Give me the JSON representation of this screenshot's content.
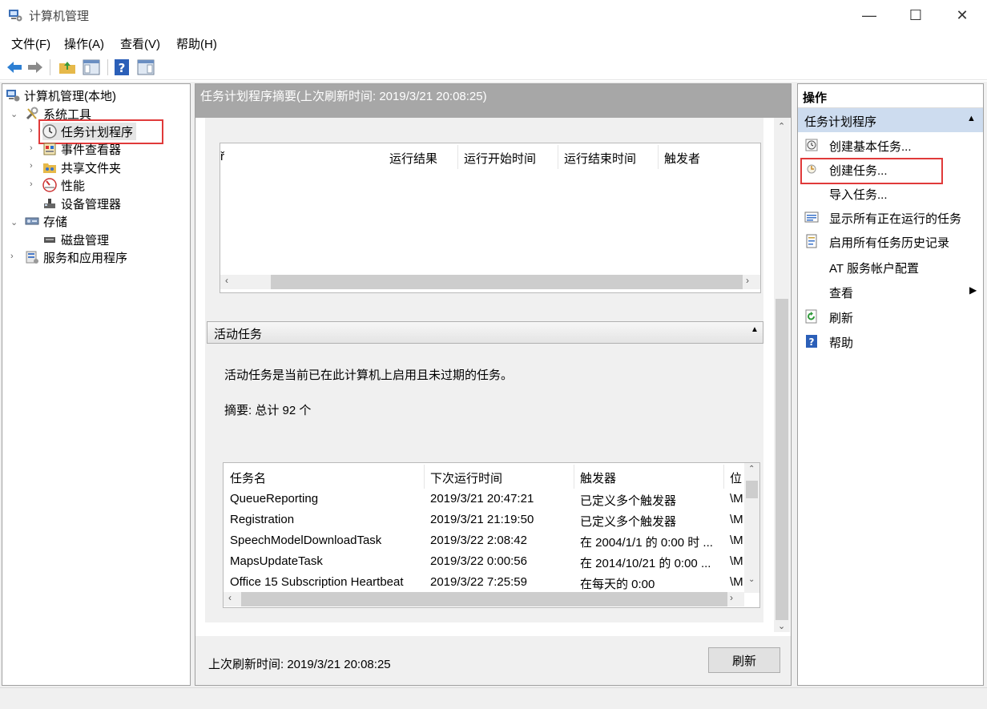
{
  "window": {
    "title": "计算机管理",
    "minimize": "—",
    "maximize": "☐",
    "close": "✕"
  },
  "menu": [
    "文件(F)",
    "操作(A)",
    "查看(V)",
    "帮助(H)"
  ],
  "tree": {
    "root": "计算机管理(本地)",
    "system_tools": "系统工具",
    "task_scheduler": "任务计划程序",
    "event_viewer": "事件查看器",
    "shared_folders": "共享文件夹",
    "performance": "性能",
    "device_manager": "设备管理器",
    "storage": "存储",
    "disk_management": "磁盘管理",
    "services_apps": "服务和应用程序"
  },
  "center": {
    "header": "任务计划程序摘要(上次刷新时间: 2019/3/21 20:08:25)",
    "top_table_cols": [
      "ř",
      "运行结果",
      "运行开始时间",
      "运行结束时间",
      "触发者"
    ],
    "active_section_title": "活动任务",
    "active_desc": "活动任务是当前已在此计算机上启用且未过期的任务。",
    "summary": "摘要: 总计 92 个",
    "task_cols": [
      "任务名",
      "下次运行时间",
      "触发器",
      "位"
    ],
    "tasks": [
      {
        "name": "QueueReporting",
        "next": "2019/3/21 20:47:21",
        "trigger": "已定义多个触发器",
        "loc": "\\M"
      },
      {
        "name": "Registration",
        "next": "2019/3/21 21:19:50",
        "trigger": "已定义多个触发器",
        "loc": "\\M"
      },
      {
        "name": "SpeechModelDownloadTask",
        "next": "2019/3/22 2:08:42",
        "trigger": "在 2004/1/1 的 0:00 时 ...",
        "loc": "\\M"
      },
      {
        "name": "MapsUpdateTask",
        "next": "2019/3/22 0:00:56",
        "trigger": "在 2014/10/21 的 0:00 ...",
        "loc": "\\M"
      },
      {
        "name": "Office 15 Subscription Heartbeat",
        "next": "2019/3/22 7:25:59",
        "trigger": "在每天的 0:00",
        "loc": "\\M"
      }
    ],
    "last_refresh": "上次刷新时间: 2019/3/21 20:08:25",
    "refresh_button": "刷新"
  },
  "actions": {
    "title": "操作",
    "section": "任务计划程序",
    "items": [
      {
        "label": "创建基本任务...",
        "icon": "basic-task-icon"
      },
      {
        "label": "创建任务...",
        "icon": "create-task-icon"
      },
      {
        "label": "导入任务...",
        "icon": ""
      },
      {
        "label": "显示所有正在运行的任务",
        "icon": "running-tasks-icon"
      },
      {
        "label": "启用所有任务历史记录",
        "icon": "history-icon"
      },
      {
        "label": "AT 服务帐户配置",
        "icon": ""
      },
      {
        "label": "查看",
        "icon": ""
      },
      {
        "label": "刷新",
        "icon": "refresh-icon"
      },
      {
        "label": "帮助",
        "icon": "help-icon"
      }
    ]
  },
  "colors": {
    "highlight_border": "#e03a3a",
    "header_gray": "#a7a7a7",
    "actions_section_bg": "#cddcef"
  }
}
